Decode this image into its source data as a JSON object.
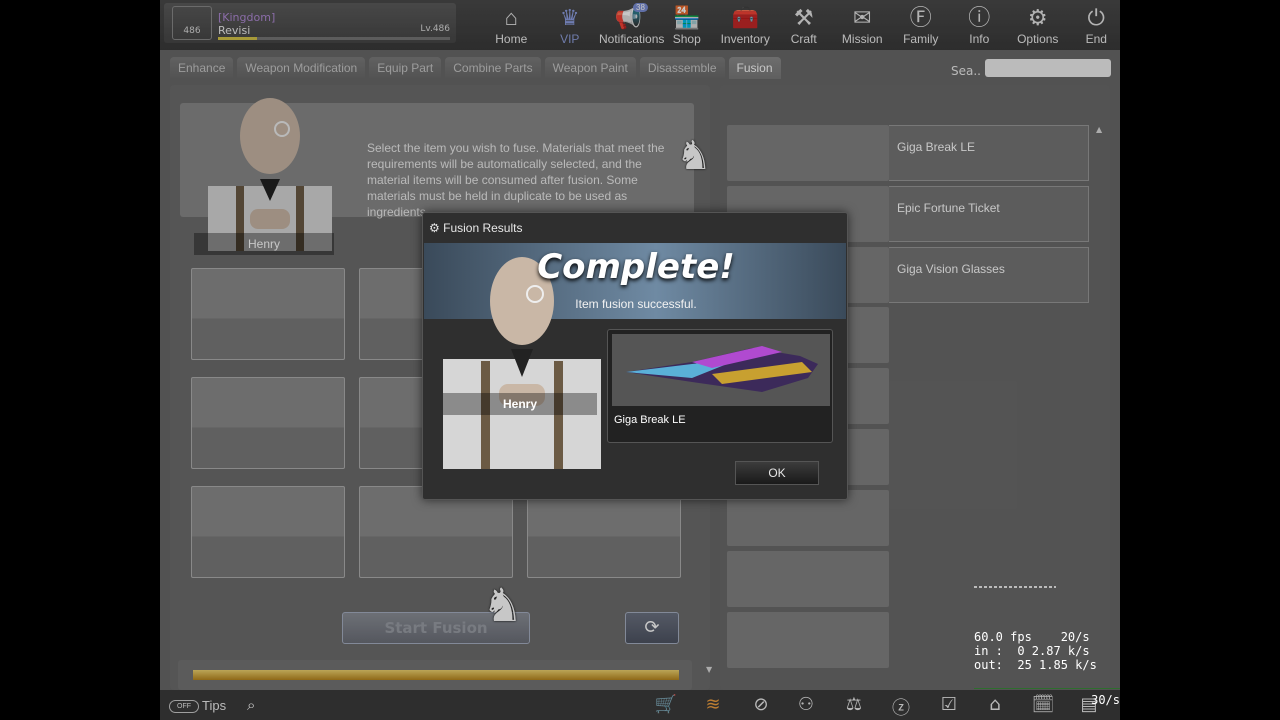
{
  "profile": {
    "rank": "486",
    "clan": "[Kingdom]",
    "name": "Revisi",
    "level": "Lv.486",
    "xp_fraction": 0.17
  },
  "nav": [
    {
      "label": "Home",
      "icon": "home-icon",
      "glyph": "⌂"
    },
    {
      "label": "VIP",
      "icon": "crown-icon",
      "glyph": "♛"
    },
    {
      "label": "Notifications",
      "icon": "megaphone-icon",
      "glyph": "📢",
      "badge": "38"
    },
    {
      "label": "Shop",
      "icon": "shop-icon",
      "glyph": "🏪"
    },
    {
      "label": "Inventory",
      "icon": "inventory-icon",
      "glyph": "🧰"
    },
    {
      "label": "Craft",
      "icon": "craft-icon",
      "glyph": "⚒"
    },
    {
      "label": "Mission",
      "icon": "mission-icon",
      "glyph": "✉"
    },
    {
      "label": "Family",
      "icon": "family-icon",
      "glyph": "Ⓕ"
    },
    {
      "label": "Info",
      "icon": "info-icon",
      "glyph": "ⓘ"
    },
    {
      "label": "Options",
      "icon": "gear-icon",
      "glyph": "⚙"
    },
    {
      "label": "End",
      "icon": "power-icon",
      "glyph": "⏻"
    }
  ],
  "tabs": [
    "Enhance",
    "Weapon Modification",
    "Equip Part",
    "Combine Parts",
    "Weapon Paint",
    "Disassemble",
    "Fusion"
  ],
  "active_tab": "Fusion",
  "search": {
    "label": "Sea..",
    "value": ""
  },
  "fusion": {
    "description": "Select the item you wish to fuse. Materials that meet the requirements will be automatically selected, and the material items will be consumed after fusion. Some materials must be held in duplicate to be used as ingredients.",
    "npc_name": "Henry",
    "start_label": "Start Fusion",
    "progress_fraction": 1.0
  },
  "item_list": [
    {
      "name": "Giga Break LE"
    },
    {
      "name": "Epic Fortune Ticket"
    },
    {
      "name": "Giga Vision Glasses"
    }
  ],
  "modal": {
    "title": "Fusion Results",
    "headline": "Complete!",
    "message": "Item fusion successful.",
    "npc_name": "Henry",
    "result_item": "Giga Break LE",
    "ok_label": "OK"
  },
  "bottom": {
    "tips_label": "Tips",
    "tips_toggle": "OFF"
  },
  "stats": {
    "fps": "60.0 fps",
    "fps_rate": "20/s",
    "in": "in :  0 2.87 k/s",
    "out": "out:  25 1.85 k/s",
    "rate2": "30/s"
  }
}
